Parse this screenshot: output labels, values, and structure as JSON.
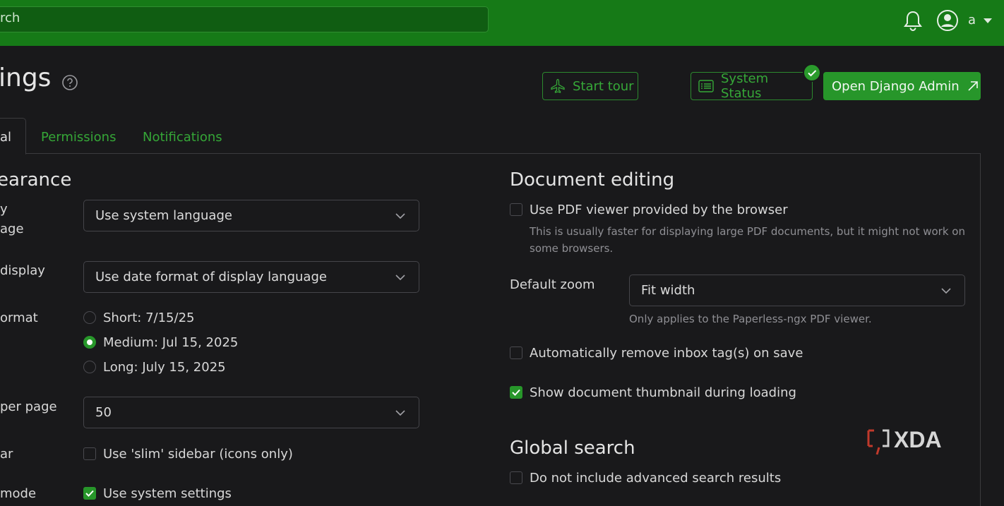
{
  "topbar": {
    "search_placeholder": "rch",
    "user_name": "a"
  },
  "header": {
    "title": "ings",
    "start_tour": "Start tour",
    "system_status": "System Status",
    "open_django_admin": "Open Django Admin"
  },
  "tabs": [
    {
      "label": "al",
      "active": true
    },
    {
      "label": "Permissions",
      "active": false
    },
    {
      "label": "Notifications",
      "active": false
    }
  ],
  "appearance": {
    "heading": "earance",
    "display_language": {
      "label_line1": "y",
      "label_line2": "age",
      "value": "Use system language"
    },
    "date_display": {
      "label": "display",
      "value": "Use date format of display language"
    },
    "date_format": {
      "label": "ormat",
      "options": [
        {
          "label": "Short: 7/15/25",
          "selected": false
        },
        {
          "label": "Medium: Jul 15, 2025",
          "selected": true
        },
        {
          "label": "Long: July 15, 2025",
          "selected": false
        }
      ]
    },
    "items_per_page": {
      "label": "per page",
      "value": "50"
    },
    "sidebar": {
      "label": "ar",
      "option": "Use 'slim' sidebar (icons only)",
      "checked": false
    },
    "dark_mode": {
      "label": "mode",
      "option": "Use system settings",
      "checked": true
    }
  },
  "document_editing": {
    "heading": "Document editing",
    "pdf_viewer": {
      "label": "Use PDF viewer provided by the browser",
      "checked": false,
      "hint_line1": "This is usually faster for displaying large PDF documents, but it might not work on",
      "hint_line2": "some browsers."
    },
    "default_zoom": {
      "label": "Default zoom",
      "value": "Fit width",
      "hint": "Only applies to the Paperless-ngx PDF viewer."
    },
    "remove_inbox": {
      "label": "Automatically remove inbox tag(s) on save",
      "checked": false
    },
    "thumbnail": {
      "label": "Show document thumbnail during loading",
      "checked": true
    }
  },
  "global_search": {
    "heading": "Global search",
    "advanced": {
      "label": "Do not include advanced search results",
      "checked": false
    }
  },
  "watermark": {
    "text": "XDA"
  },
  "colors": {
    "accent": "#27962a",
    "topbar": "#167a17",
    "background": "#19191b"
  }
}
